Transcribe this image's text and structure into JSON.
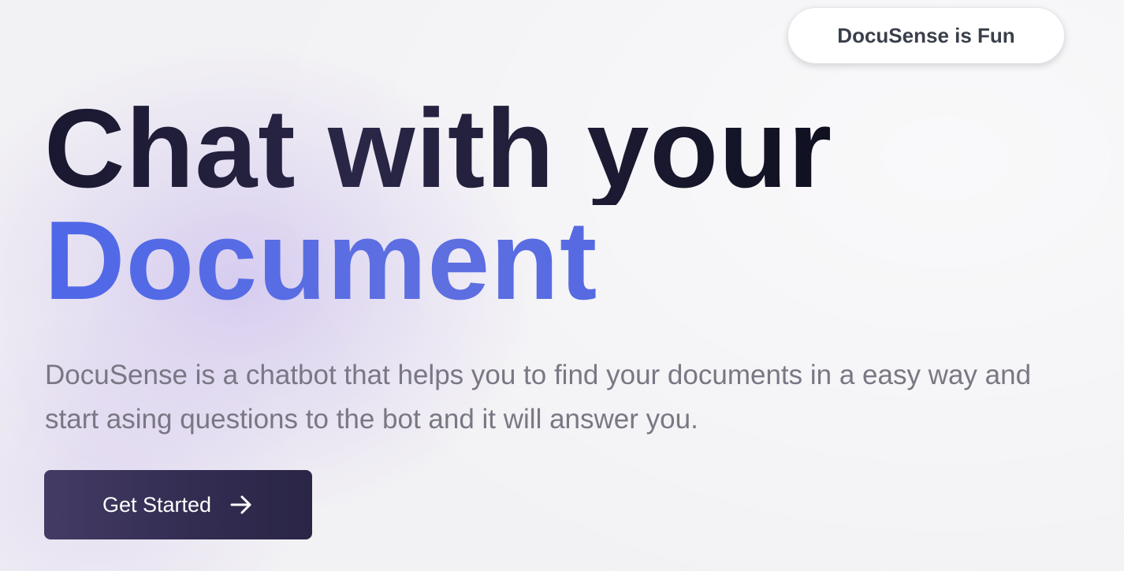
{
  "badge": {
    "label": "DocuSense is Fun"
  },
  "hero": {
    "headline_line1": "Chat with your",
    "headline_line2": "Document",
    "description_line1": "DocuSense is a chatbot that helps you to find your documents in a easy way and",
    "description_line2": "start asing questions to the bot and it will answer you."
  },
  "cta": {
    "label": "Get Started",
    "icon": "arrow-right-icon"
  },
  "colors": {
    "headline_dark": "#15142a",
    "headline_accent": "#5a6be6",
    "description_text": "#7a7784",
    "button_bg": "#3a3358",
    "badge_bg": "#ffffff"
  }
}
